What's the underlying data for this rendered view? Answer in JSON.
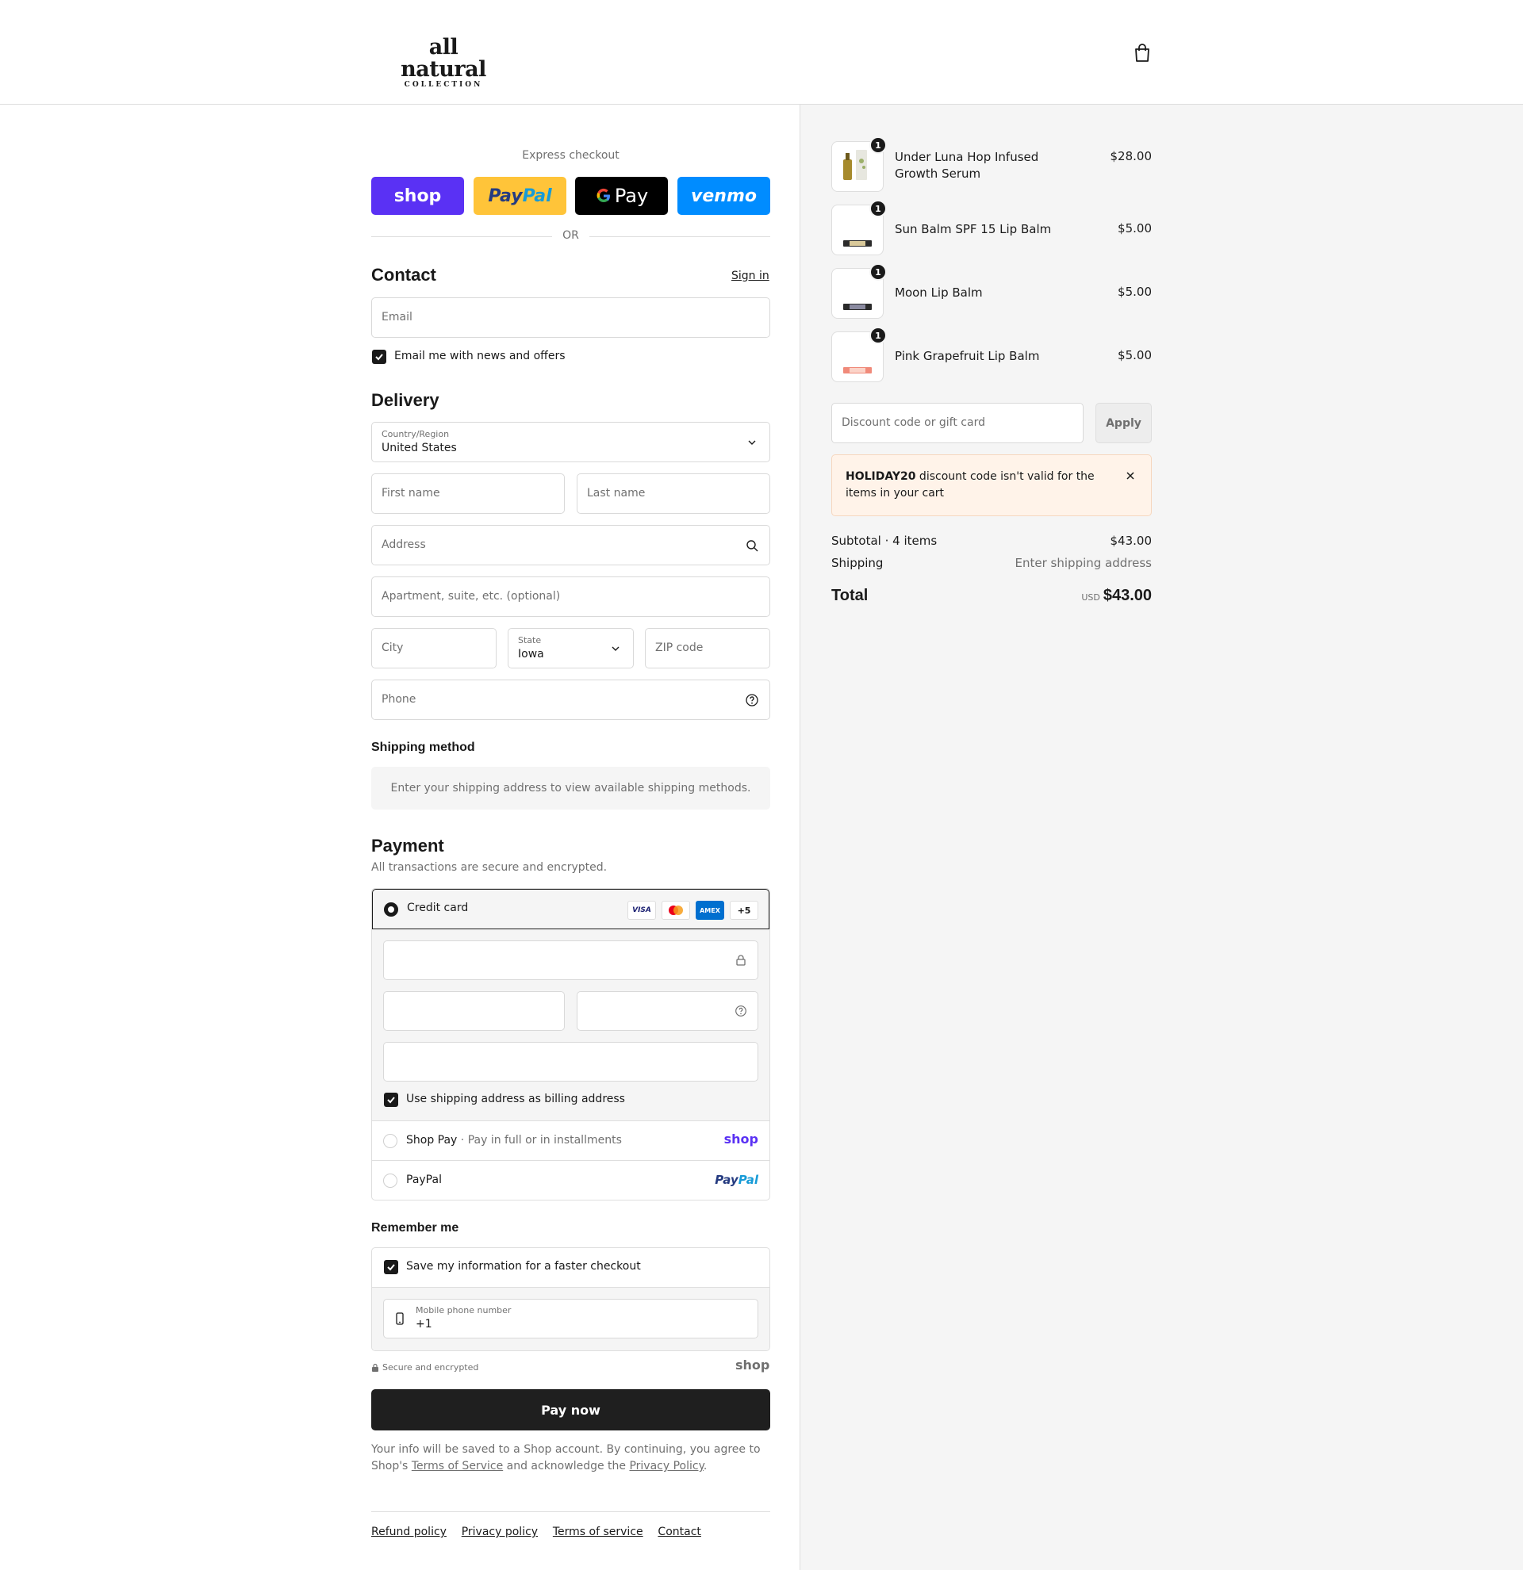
{
  "header": {
    "logo_main": "all natural",
    "logo_sub": "COLLECTION"
  },
  "express": {
    "label": "Express checkout",
    "buttons": {
      "shop": "shop",
      "paypal_pay": "Pay",
      "paypal_pal": "Pal",
      "gpay": "Pay",
      "venmo": "venmo"
    },
    "or": "OR"
  },
  "contact": {
    "title": "Contact",
    "sign_in": "Sign in",
    "email_placeholder": "Email",
    "news_label": "Email me with news and offers"
  },
  "delivery": {
    "title": "Delivery",
    "country_label": "Country/Region",
    "country_value": "United States",
    "first_name": "First name",
    "last_name": "Last name",
    "address": "Address",
    "apartment": "Apartment, suite, etc. (optional)",
    "city": "City",
    "state_label": "State",
    "state_value": "Iowa",
    "zip": "ZIP code",
    "phone": "Phone"
  },
  "shipping": {
    "title": "Shipping method",
    "message": "Enter your shipping address to view available shipping methods."
  },
  "payment": {
    "title": "Payment",
    "subtitle": "All transactions are secure and encrypted.",
    "credit_card": "Credit card",
    "badges": {
      "visa": "VISA",
      "amex": "AMEX",
      "more": "+5"
    },
    "billing_same": "Use shipping address as billing address",
    "shop_pay": "Shop Pay",
    "shop_pay_desc": "· Pay in full or in installments",
    "shop_logo": "shop",
    "paypal": "PayPal",
    "paypal_logo_pay": "Pay",
    "paypal_logo_pal": "Pal"
  },
  "remember": {
    "title": "Remember me",
    "save_label": "Save my information for a faster checkout",
    "mobile_label": "Mobile phone number",
    "mobile_value": "+1"
  },
  "secure": {
    "label": "Secure and encrypted",
    "shop_logo": "shop"
  },
  "pay_now": "Pay now",
  "legal": {
    "part1": "Your info will be saved to a Shop account. By continuing, you agree to Shop's ",
    "tos": "Terms of Service",
    "part2": " and acknowledge the ",
    "privacy": "Privacy Policy",
    "part3": "."
  },
  "footer": {
    "refund": "Refund policy",
    "privacy": "Privacy policy",
    "terms": "Terms of service",
    "contact": "Contact"
  },
  "cart": {
    "items": [
      {
        "name": "Under Luna Hop Infused Growth Serum",
        "price": "$28.00",
        "qty": "1"
      },
      {
        "name": "Sun Balm SPF 15 Lip Balm",
        "price": "$5.00",
        "qty": "1"
      },
      {
        "name": "Moon Lip Balm",
        "price": "$5.00",
        "qty": "1"
      },
      {
        "name": "Pink Grapefruit Lip Balm",
        "price": "$5.00",
        "qty": "1"
      }
    ],
    "discount_placeholder": "Discount code or gift card",
    "apply": "Apply",
    "error_code": "HOLIDAY20",
    "error_text": " discount code isn't valid for the items in your cart",
    "subtotal_label": "Subtotal · 4 items",
    "subtotal_value": "$43.00",
    "shipping_label": "Shipping",
    "shipping_value": "Enter shipping address",
    "total_label": "Total",
    "currency": "USD",
    "total_value": "$43.00"
  },
  "colors": {
    "shop_purple": "#5a31f4",
    "paypal_yellow": "#ffc439",
    "venmo_blue": "#008cff",
    "error_bg": "#fff3e9"
  }
}
